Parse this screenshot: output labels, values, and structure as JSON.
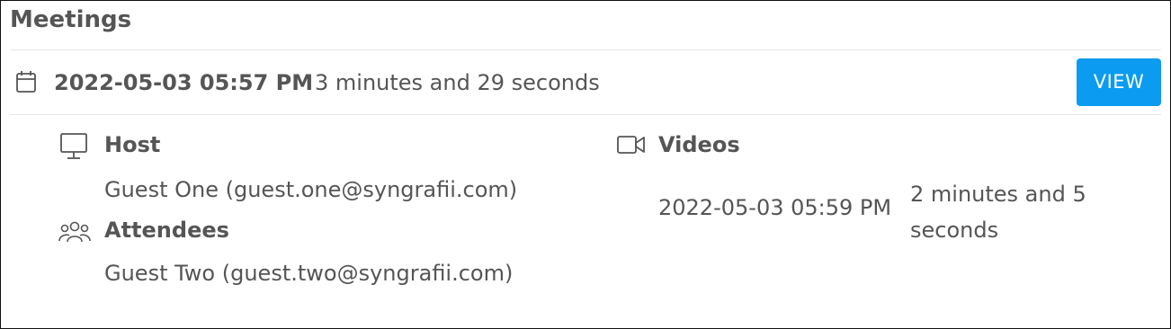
{
  "panel": {
    "title": "Meetings"
  },
  "meeting": {
    "date": "2022-05-03 05:57 PM",
    "duration": "3 minutes and 29 seconds",
    "view_label": "VIEW",
    "view_color": "#0b9bf0"
  },
  "host": {
    "heading": "Host",
    "icon": "monitor-icon",
    "value": "Guest One (guest.one@syngrafii.com)"
  },
  "attendees": {
    "heading": "Attendees",
    "icon": "users-icon",
    "value": "Guest Two (guest.two@syngrafii.com)"
  },
  "videos": {
    "heading": "Videos",
    "icon": "video-camera-icon",
    "items": [
      {
        "date": "2022-05-03 05:59 PM",
        "duration": "2 minutes and 5 seconds"
      }
    ]
  }
}
